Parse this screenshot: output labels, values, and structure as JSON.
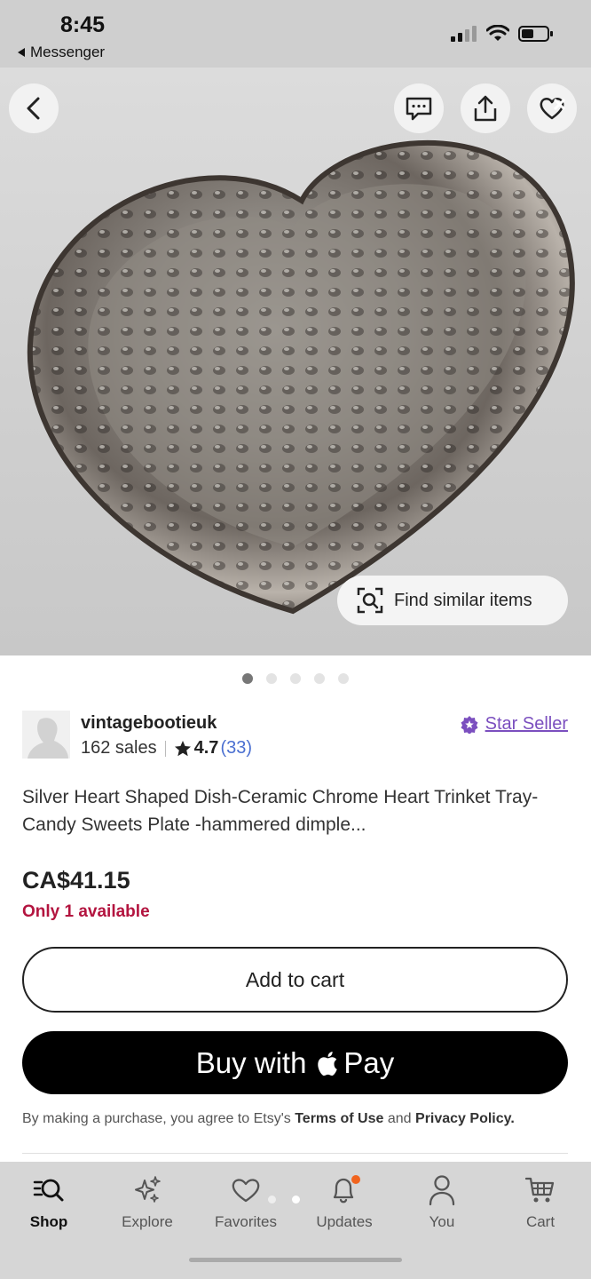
{
  "status_bar": {
    "time": "8:45",
    "back_app": "Messenger"
  },
  "hero": {
    "find_similar_label": "Find similar items",
    "image_count": 5,
    "active_image": 1
  },
  "seller": {
    "shop_name": "vintagebootieuk",
    "sales": "162 sales",
    "rating": "4.7",
    "review_count": "(33)",
    "badge_label": "Star Seller"
  },
  "listing": {
    "title": "Silver Heart Shaped Dish-Ceramic Chrome Heart Trinket Tray-Candy Sweets Plate -hammered dimple...",
    "price": "CA$41.15",
    "availability": "Only 1 available"
  },
  "actions": {
    "add_to_cart": "Add to cart",
    "buy_with": "Buy with",
    "pay": "Pay"
  },
  "legal": {
    "prefix": "By making a purchase, you agree to Etsy's",
    "terms": "Terms of Use",
    "and": "and",
    "privacy": "Privacy Policy."
  },
  "nav": {
    "items": [
      {
        "label": "Shop",
        "active": true
      },
      {
        "label": "Explore",
        "active": false
      },
      {
        "label": "Favorites",
        "active": false
      },
      {
        "label": "Updates",
        "active": false
      },
      {
        "label": "You",
        "active": false
      },
      {
        "label": "Cart",
        "active": false
      }
    ]
  },
  "colors": {
    "accent_purple": "#7b4fbf",
    "availability_red": "#b3143f",
    "notification_orange": "#f1641e",
    "link_blue": "#4a6fd1"
  }
}
